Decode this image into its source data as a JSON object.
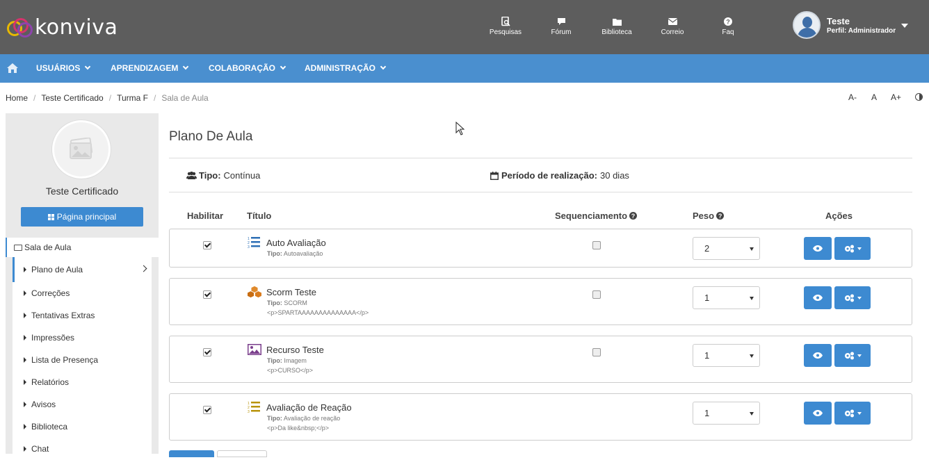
{
  "brand": {
    "name": "konviva"
  },
  "topnav": [
    {
      "label": "Pesquisas",
      "icon": "search-doc-icon"
    },
    {
      "label": "Fórum",
      "icon": "comment-icon"
    },
    {
      "label": "Biblioteca",
      "icon": "folder-icon"
    },
    {
      "label": "Correio",
      "icon": "envelope-icon"
    },
    {
      "label": "Faq",
      "icon": "question-circle-icon"
    }
  ],
  "user": {
    "name": "Teste",
    "profile": "Perfil: Administrador"
  },
  "menu": [
    {
      "label": "USUÁRIOS"
    },
    {
      "label": "APRENDIZAGEM"
    },
    {
      "label": "COLABORAÇÃO"
    },
    {
      "label": "ADMINISTRAÇÃO"
    }
  ],
  "breadcrumb": [
    "Home",
    "Teste Certificado",
    "Turma F",
    "Sala de Aula"
  ],
  "font_controls": [
    "A-",
    "A",
    "A+"
  ],
  "sidebar": {
    "course_name": "Teste Certificado",
    "main_button": "Página principal",
    "root_item": "Sala de Aula",
    "items": [
      {
        "label": "Plano de Aula"
      },
      {
        "label": "Correções"
      },
      {
        "label": "Tentativas Extras"
      },
      {
        "label": "Impressões"
      },
      {
        "label": "Lista de Presença"
      },
      {
        "label": "Relatórios"
      },
      {
        "label": "Avisos"
      },
      {
        "label": "Biblioteca"
      },
      {
        "label": "Chat"
      }
    ]
  },
  "main": {
    "title": "Plano De Aula",
    "tipo_label": "Tipo:",
    "tipo_value": "Contínua",
    "periodo_label": "Período de realização:",
    "periodo_value": "30 dias",
    "columns": {
      "habilitar": "Habilitar",
      "titulo": "Título",
      "sequenciamento": "Sequenciamento",
      "peso": "Peso",
      "acoes": "Ações"
    },
    "type_prefix": "Tipo:",
    "rows": [
      {
        "title": "Auto Avaliação",
        "type": "Autoavaliação",
        "desc": "",
        "peso": "2",
        "enabled": true,
        "icon": "list-numbered-icon"
      },
      {
        "title": "Scorm Teste",
        "type": "SCORM",
        "desc": "<p>SPARTAAAAAAAAAAAAAA</p>",
        "peso": "1",
        "enabled": true,
        "icon": "cubes-icon"
      },
      {
        "title": "Recurso Teste",
        "type": "Imagem",
        "desc": "<p>CURSO</p>",
        "peso": "1",
        "enabled": true,
        "icon": "image-icon"
      },
      {
        "title": "Avaliação de Reação",
        "type": "Avaliação de reação",
        "desc": "<p>Da like&nbsp;</p>",
        "peso": "1",
        "enabled": true,
        "icon": "list-numbered-gold-icon"
      }
    ]
  },
  "colors": {
    "topbar": "#5d5d5d",
    "menubar": "#4a8fcf",
    "primary": "#3d8ad1"
  }
}
